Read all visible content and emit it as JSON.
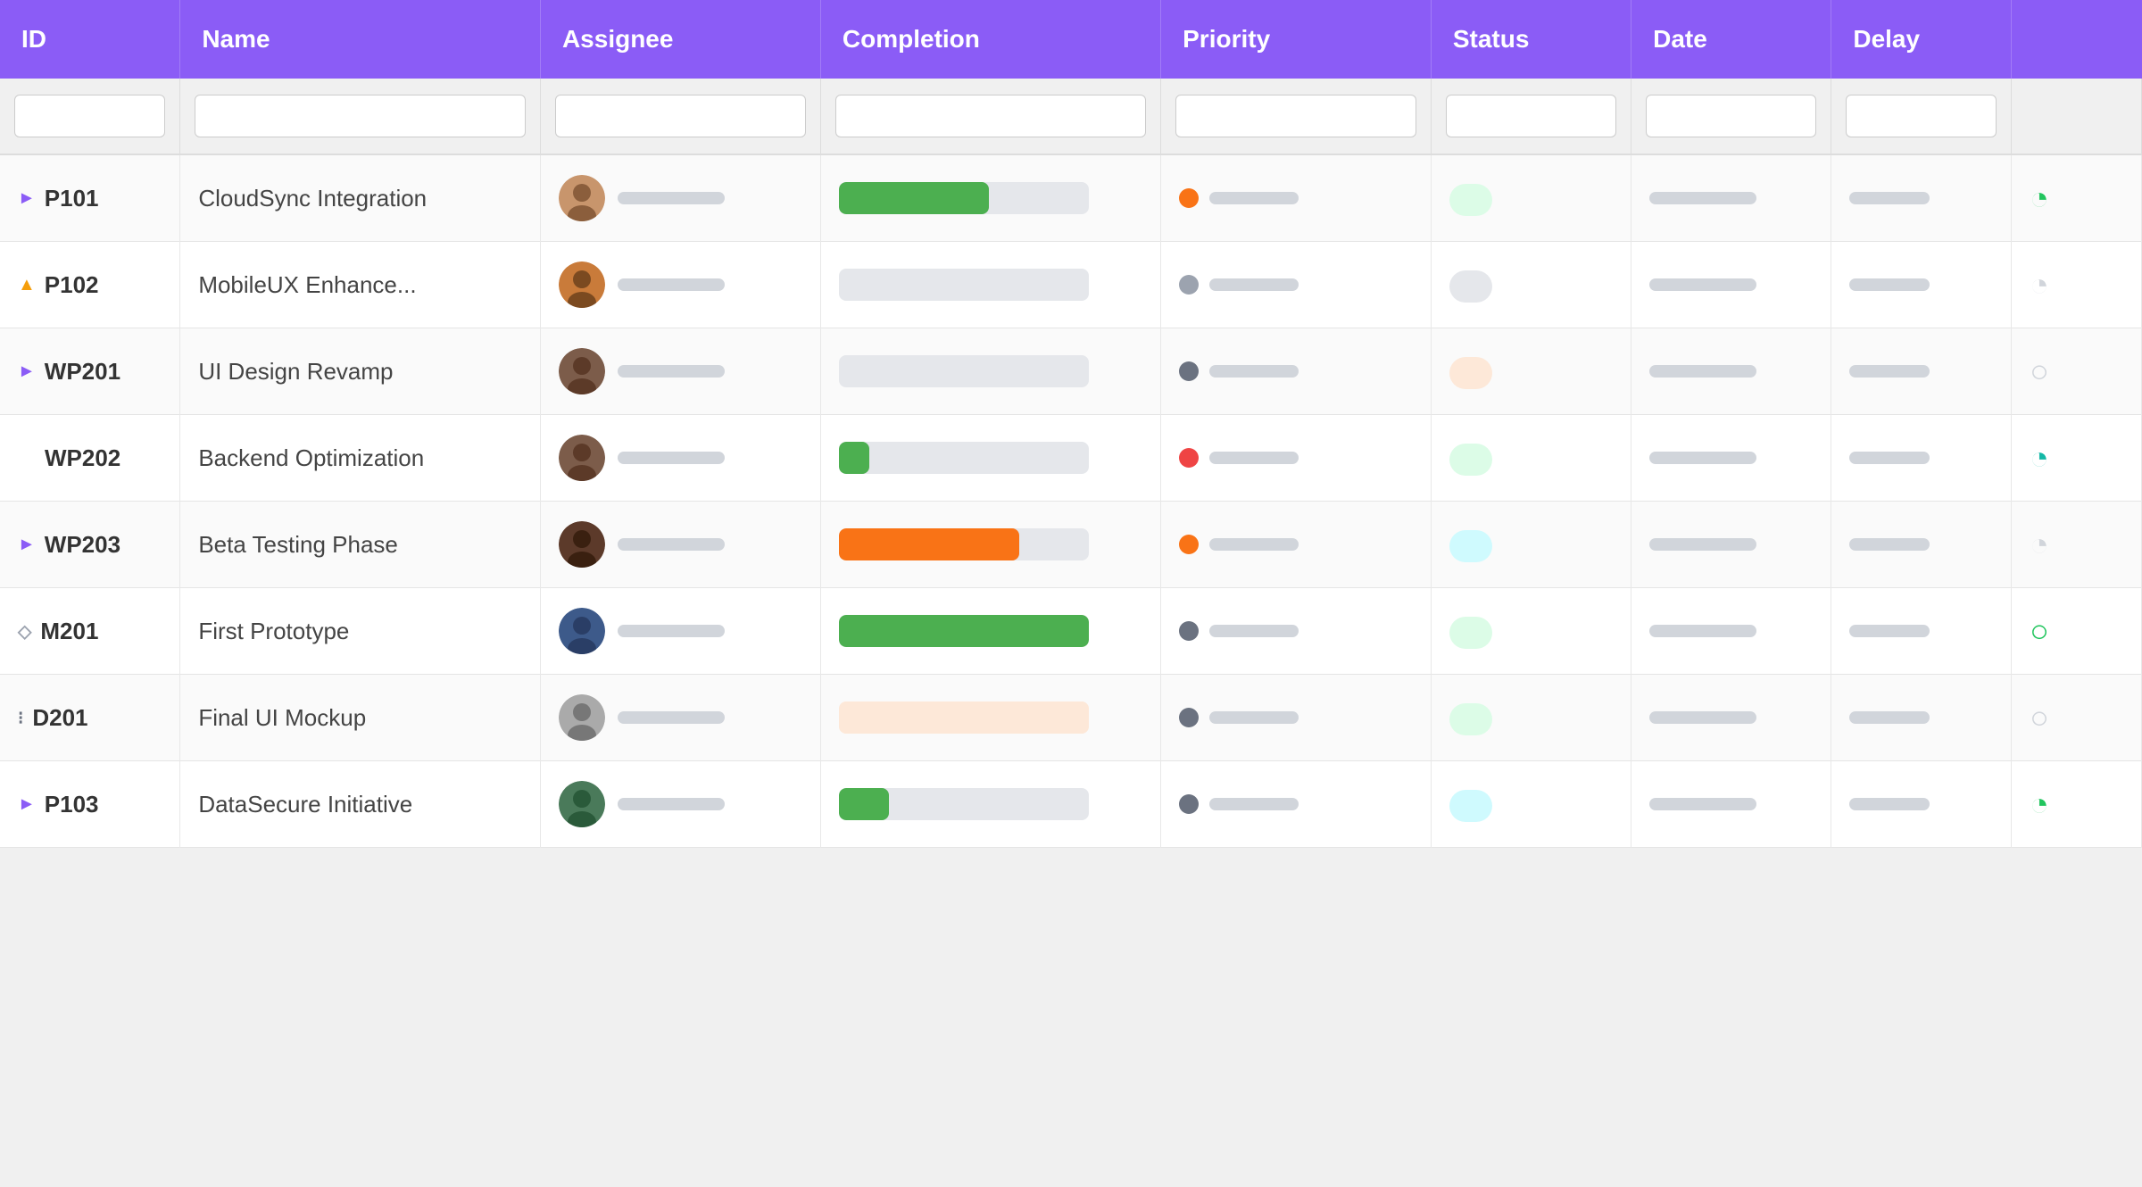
{
  "table": {
    "columns": [
      "ID",
      "Name",
      "Assignee",
      "Completion",
      "Priority",
      "Status",
      "Date",
      "Delay",
      ""
    ],
    "rows": [
      {
        "id": "P101",
        "id_icon": "triangle-right",
        "name": "CloudSync Integration",
        "assignee_color": "#7b4f2a",
        "assignee_bg": "#c8956c",
        "completion_pct": 60,
        "completion_type": "green",
        "priority_color": "orange",
        "status_color": "light-green",
        "delay_icon": "◔",
        "delay_color": "green"
      },
      {
        "id": "P102",
        "id_icon": "triangle-orange",
        "name": "MobileUX Enhance...",
        "assignee_color": "#6b3a1f",
        "assignee_bg": "#c97b3a",
        "completion_pct": 0,
        "completion_type": "none",
        "priority_color": "gray",
        "status_color": "gray",
        "delay_icon": "◔",
        "delay_color": "gray"
      },
      {
        "id": "WP201",
        "id_icon": "triangle-right",
        "name": "UI Design Revamp",
        "assignee_color": "#3d2b1f",
        "assignee_bg": "#7c5c4a",
        "completion_pct": 0,
        "completion_type": "none",
        "priority_color": "dark",
        "status_color": "peach",
        "delay_icon": "○",
        "delay_color": "gray"
      },
      {
        "id": "WP202",
        "id_icon": "none",
        "name": "Backend Optimization",
        "assignee_color": "#3d2b1f",
        "assignee_bg": "#7c5c4a",
        "completion_pct": 12,
        "completion_type": "green",
        "priority_color": "red",
        "status_color": "light-green",
        "delay_icon": "◔",
        "delay_color": "teal"
      },
      {
        "id": "WP203",
        "id_icon": "triangle-right",
        "name": "Beta Testing Phase",
        "assignee_color": "#2c1a10",
        "assignee_bg": "#5c3a2a",
        "completion_pct": 72,
        "completion_type": "orange",
        "priority_color": "orange",
        "status_color": "light-blue",
        "delay_icon": "◔",
        "delay_color": "gray"
      },
      {
        "id": "M201",
        "id_icon": "diamond",
        "name": "First Prototype",
        "assignee_color": "#1a2e4a",
        "assignee_bg": "#3d5a8a",
        "completion_pct": 100,
        "completion_type": "green",
        "priority_color": "dark",
        "status_color": "light-green",
        "delay_icon": "○",
        "delay_color": "green"
      },
      {
        "id": "D201",
        "id_icon": "grid",
        "name": "Final UI Mockup",
        "assignee_color": "#3a3a3a",
        "assignee_bg": "#888",
        "completion_pct": 0,
        "completion_type": "peach",
        "priority_color": "dark",
        "status_color": "light-green",
        "delay_icon": "○",
        "delay_color": "gray"
      },
      {
        "id": "P103",
        "id_icon": "triangle-right",
        "name": "DataSecure Initiative",
        "assignee_color": "#1a3a2a",
        "assignee_bg": "#4a7a5a",
        "completion_pct": 20,
        "completion_type": "green",
        "priority_color": "dark",
        "status_color": "light-blue",
        "delay_icon": "◔",
        "delay_color": "green"
      }
    ]
  }
}
